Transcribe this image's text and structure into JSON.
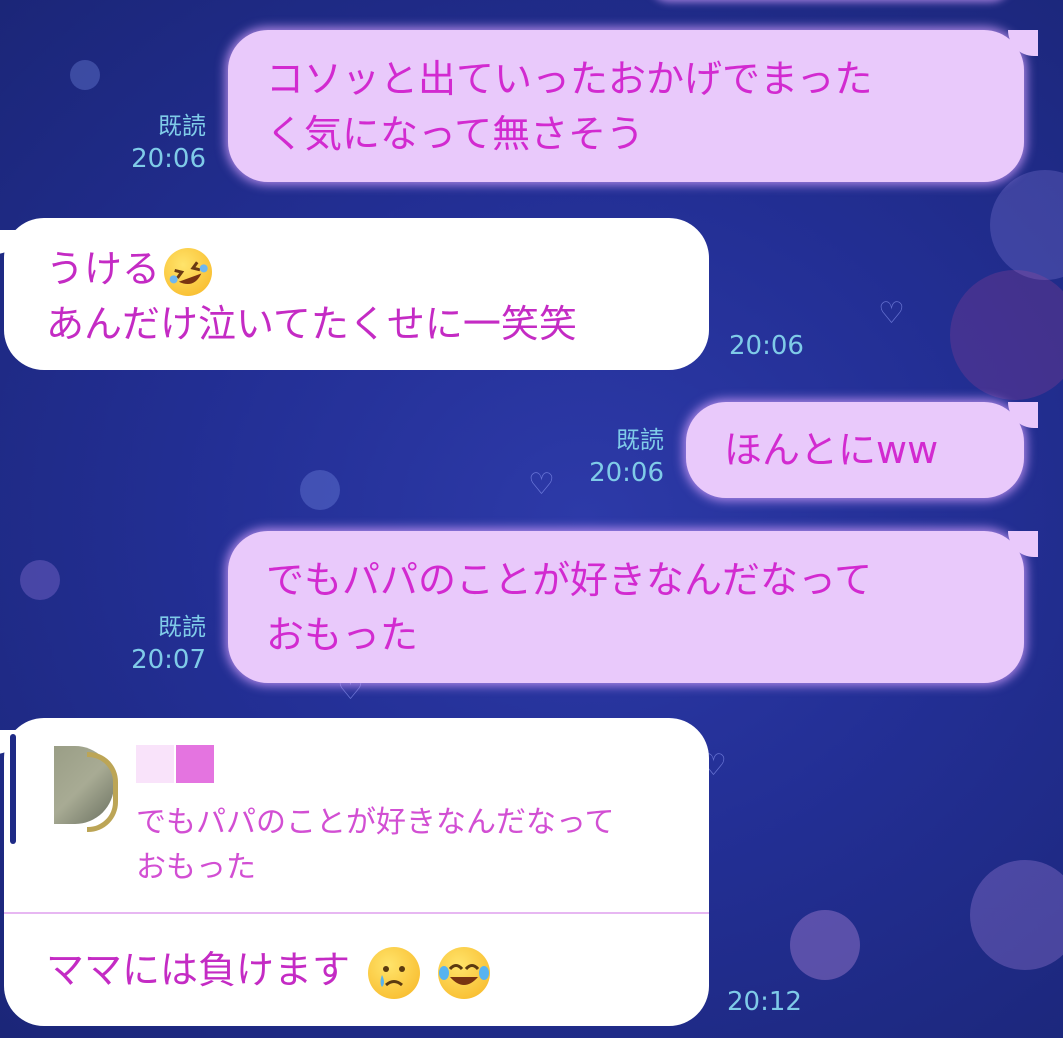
{
  "messages": [
    {
      "id": "m1",
      "side": "outgoing",
      "lines": [
        "コソッと出ていったおかげでまった",
        "く気になって無さそう"
      ],
      "read_label": "既読",
      "time": "20:06"
    },
    {
      "id": "m2",
      "side": "incoming",
      "lines": [
        "うける",
        "あんだけ泣いてたくせに一笑笑"
      ],
      "emoji": "rolling-on-floor-laughing",
      "time": "20:06"
    },
    {
      "id": "m3",
      "side": "outgoing",
      "lines": [
        "ほんとにww"
      ],
      "read_label": "既読",
      "time": "20:06"
    },
    {
      "id": "m4",
      "side": "outgoing",
      "lines": [
        "でもパパのことが好きなんだなって",
        "おもった"
      ],
      "read_label": "既読",
      "time": "20:07"
    },
    {
      "id": "m5",
      "side": "incoming",
      "quote": {
        "lines": [
          "でもパパのことが好きなんだなって",
          "おもった"
        ]
      },
      "text": "ママには負けます",
      "emojis": [
        "crying-face",
        "tears-of-joy-face"
      ],
      "time": "20:12"
    }
  ],
  "colors": {
    "background": "#232f95",
    "outgoing_bubble": "#e9c9fb",
    "incoming_bubble": "#ffffff",
    "text": "#d22ad0",
    "meta": "#7fcbe8"
  }
}
